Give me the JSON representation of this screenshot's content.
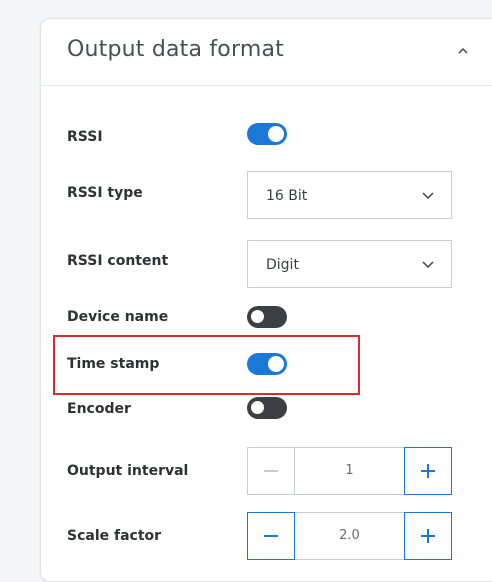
{
  "panel": {
    "title": "Output data format"
  },
  "rows": {
    "rssi": {
      "label": "RSSI",
      "enabled": true
    },
    "rssi_type": {
      "label": "RSSI type",
      "value": "16 Bit"
    },
    "rssi_content": {
      "label": "RSSI content",
      "value": "Digit"
    },
    "device_name": {
      "label": "Device name",
      "enabled": false
    },
    "time_stamp": {
      "label": "Time stamp",
      "enabled": true
    },
    "encoder": {
      "label": "Encoder",
      "enabled": false
    },
    "output_interval": {
      "label": "Output interval",
      "value": "1",
      "minus_enabled": false
    },
    "scale_factor": {
      "label": "Scale factor",
      "value": "2.0",
      "minus_enabled": true
    }
  },
  "colors": {
    "accent": "#1b78d6",
    "toggle_off": "#3c3f43",
    "highlight": "#e0282e"
  }
}
